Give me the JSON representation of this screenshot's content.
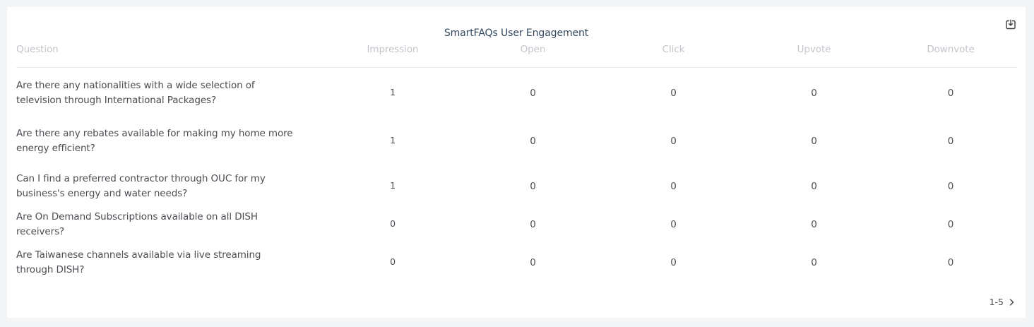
{
  "widget": {
    "title": "SmartFAQs User Engagement",
    "download_icon": "download-icon"
  },
  "table": {
    "headers": [
      "Question",
      "Impression",
      "Open",
      "Click",
      "Upvote",
      "Downvote"
    ],
    "rows": [
      {
        "question": "Are there any nationalities with a wide selection of television through International Packages?",
        "impression": "1",
        "open": "0",
        "click": "0",
        "upvote": "0",
        "downvote": "0"
      },
      {
        "question": "Are there any rebates available for making my home more energy efficient?",
        "impression": "1",
        "open": "0",
        "click": "0",
        "upvote": "0",
        "downvote": "0"
      },
      {
        "question": "Can I find a preferred contractor through OUC for my business's energy and water needs?",
        "impression": "1",
        "open": "0",
        "click": "0",
        "upvote": "0",
        "downvote": "0"
      },
      {
        "question": "Are On Demand Subscriptions available on all DISH receivers?",
        "impression": "0",
        "open": "0",
        "click": "0",
        "upvote": "0",
        "downvote": "0"
      },
      {
        "question": "Are Taiwanese channels available via live streaming through DISH?",
        "impression": "0",
        "open": "0",
        "click": "0",
        "upvote": "0",
        "downvote": "0"
      }
    ]
  },
  "pagination": {
    "range": "1-5",
    "next_icon": "chevron-right-icon"
  }
}
